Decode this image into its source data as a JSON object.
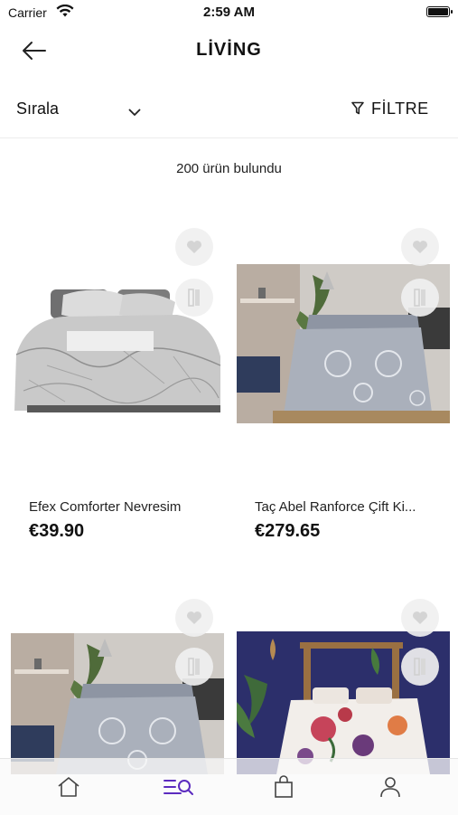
{
  "status": {
    "carrier": "Carrier",
    "time": "2:59 AM"
  },
  "nav": {
    "title": "LİVİNG"
  },
  "toolbar": {
    "sort_label": "Sırala",
    "filter_label": "FİLTRE"
  },
  "results_count": "200 ürün bulundu",
  "products": [
    {
      "name": "Efex Comforter Nevresim",
      "price": "€39.90"
    },
    {
      "name": "Taç Abel Ranforce Çift Ki...",
      "price": "€279.65"
    },
    {
      "name": "",
      "price": ""
    },
    {
      "name": "",
      "price": ""
    }
  ],
  "tabbar": {
    "items": [
      "home-icon",
      "catalog-search-icon",
      "bag-icon",
      "profile-icon"
    ],
    "active": 1,
    "accent": "#5b2bbf"
  }
}
